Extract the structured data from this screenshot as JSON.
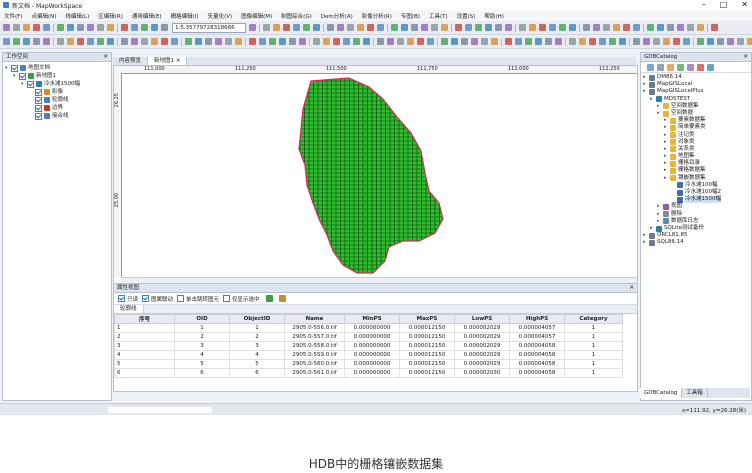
{
  "window": {
    "title": "新文档 - MapWorkSpace",
    "controls": [
      "–",
      "□",
      "✕"
    ]
  },
  "menu": [
    "文件(F)",
    "点编辑(N)",
    "线编辑(L)",
    "区编辑(R)",
    "通用编辑(E)",
    "栅格编辑(I)",
    "矢量化(V)",
    "图像编辑(M)",
    "制图综合(G)",
    "Dem分析(A)",
    "影像分析(R)",
    "专图(B)",
    "工具(T)",
    "设置(S)",
    "帮助(H)"
  ],
  "toolbar": {
    "scale_value": "1:5.35779728318666"
  },
  "left_panel": {
    "title": "工作空间",
    "tree": [
      {
        "label": "地图文档",
        "level": 0,
        "checked": true,
        "icon": "document-icon"
      },
      {
        "label": "新地图1",
        "level": 1,
        "checked": true,
        "icon": "map-icon"
      },
      {
        "label": "冷水滩1500幅",
        "level": 2,
        "checked": true,
        "icon": "raster-layer-icon"
      },
      {
        "label": "影像",
        "level": 3,
        "checked": true,
        "icon": "image-layer-icon"
      },
      {
        "label": "轮廓线",
        "level": 3,
        "checked": true,
        "icon": "line-layer-icon"
      },
      {
        "label": "边界",
        "level": 3,
        "checked": true,
        "icon": "region-layer-icon"
      },
      {
        "label": "接合线",
        "level": 3,
        "checked": true,
        "icon": "line-layer-icon"
      }
    ]
  },
  "map_tabs": [
    "内容预览",
    "新地图1"
  ],
  "ruler": {
    "top": [
      "111.000",
      "111.250",
      "111.500",
      "111.750",
      "112.000",
      "112.250"
    ],
    "left": [
      "26.25",
      "25.00"
    ]
  },
  "attr_panel": {
    "title": "属性视图",
    "options": [
      {
        "label": "只读",
        "checked": true
      },
      {
        "label": "图属联动",
        "checked": true
      },
      {
        "label": "单击跳转图元",
        "checked": false
      },
      {
        "label": "仅显示选中",
        "checked": false
      }
    ],
    "tab": "轮廓线",
    "columns": [
      "序号",
      "OID",
      "ObjectID",
      "Name",
      "MinPS",
      "MaxPS",
      "LowPS",
      "HighPS",
      "Category"
    ],
    "rows": [
      [
        "1",
        "1",
        "1",
        "2905.0-556.0.tif",
        "0.000000000",
        "0.000012150",
        "0.000002029",
        "0.000004057",
        "1"
      ],
      [
        "2",
        "2",
        "2",
        "2905.0-557.0.tif",
        "0.000000000",
        "0.000012150",
        "0.000002029",
        "0.000004057",
        "1"
      ],
      [
        "3",
        "3",
        "3",
        "2905.0-558.0.tif",
        "0.000000000",
        "0.000012150",
        "0.000002029",
        "0.000004058",
        "1"
      ],
      [
        "4",
        "4",
        "4",
        "2905.0-559.0.tif",
        "0.000000000",
        "0.000012150",
        "0.000002029",
        "0.000004058",
        "1"
      ],
      [
        "5",
        "5",
        "5",
        "2905.0-560.0.tif",
        "0.000000000",
        "0.000012150",
        "0.000002029",
        "0.000004058",
        "1"
      ],
      [
        "6",
        "6",
        "6",
        "2905.0-561.0.tif",
        "0.000000000",
        "0.000012150",
        "0.000002030",
        "0.000004058",
        "1"
      ]
    ]
  },
  "right_panel": {
    "title": "GDBCatalog",
    "tree": [
      {
        "label": "DM86.14",
        "level": 0,
        "icon": "server-icon"
      },
      {
        "label": "MapGISLocal",
        "level": 0,
        "icon": "server-icon"
      },
      {
        "label": "MapGISLocalPlus",
        "level": 0,
        "icon": "server-icon"
      },
      {
        "label": "MDSTEST",
        "level": 1,
        "icon": "database-icon"
      },
      {
        "label": "空间数据集",
        "level": 2,
        "icon": "folder-icon"
      },
      {
        "label": "空间数据",
        "level": 2,
        "icon": "folder-icon"
      },
      {
        "label": "要素数据集",
        "level": 3,
        "icon": "folder-icon"
      },
      {
        "label": "简单要素类",
        "level": 3,
        "icon": "folder-icon"
      },
      {
        "label": "注记类",
        "level": 3,
        "icon": "folder-icon"
      },
      {
        "label": "对象类",
        "level": 3,
        "icon": "folder-icon"
      },
      {
        "label": "关系类",
        "level": 3,
        "icon": "folder-icon"
      },
      {
        "label": "地图集",
        "level": 3,
        "icon": "folder-icon"
      },
      {
        "label": "栅格目录",
        "level": 3,
        "icon": "folder-icon"
      },
      {
        "label": "栅格数据集",
        "level": 3,
        "icon": "folder-icon"
      },
      {
        "label": "镶嵌数据集",
        "level": 3,
        "icon": "folder-icon"
      },
      {
        "label": "冷水滩100幅",
        "level": 4,
        "icon": "mosaic-icon"
      },
      {
        "label": "冷水滩100幅2",
        "level": 4,
        "icon": "mosaic-icon"
      },
      {
        "label": "冷水滩1500幅",
        "level": 4,
        "icon": "mosaic-icon"
      },
      {
        "label": "视图",
        "level": 2,
        "icon": "view-icon"
      },
      {
        "label": "删除",
        "level": 2,
        "icon": "trash-icon"
      },
      {
        "label": "数据库日志",
        "level": 2,
        "icon": "log-icon"
      },
      {
        "label": "SQLite测试备份",
        "level": 1,
        "icon": "database-icon"
      },
      {
        "label": "ORCL81.85",
        "level": 0,
        "icon": "server-icon"
      },
      {
        "label": "SQL86.14",
        "level": 0,
        "icon": "server-icon"
      }
    ],
    "bottom_tabs": [
      "GDBCatalog",
      "工具箱"
    ]
  },
  "status": {
    "coords": "x=111.92, y=26.28(米)"
  },
  "caption": "HDB中的栅格镶嵌数据集",
  "colors": {
    "mosaic_fill": "#2fbf2f",
    "mosaic_grid": "#0b3d0b",
    "mosaic_outline": "#e0245e"
  }
}
